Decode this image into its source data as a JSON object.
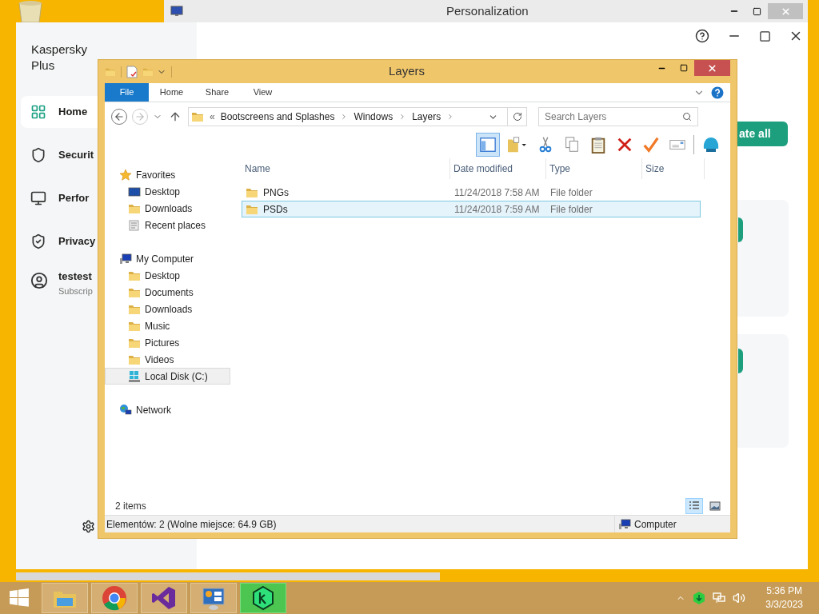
{
  "personalization_window": {
    "title": "Personalization"
  },
  "kaspersky": {
    "app_name": "Kaspersky Plus",
    "nav": [
      {
        "label": "Home",
        "selected": true
      },
      {
        "label": "Securit",
        "selected": false
      },
      {
        "label": "Perfor",
        "selected": false
      },
      {
        "label": "Privacy",
        "selected": false
      }
    ],
    "account": {
      "name": "testest",
      "subtitle": "Subscrip"
    },
    "update_button": "ate all"
  },
  "explorer": {
    "title": "Layers",
    "ribbon_tabs": [
      {
        "label": "File",
        "kind": "file"
      },
      {
        "label": "Home",
        "kind": "tab"
      },
      {
        "label": "Share",
        "kind": "tab"
      },
      {
        "label": "View",
        "kind": "tab"
      }
    ],
    "breadcrumb": {
      "overflow": "«",
      "items": [
        "Bootscreens and Splashes",
        "Windows",
        "Layers"
      ]
    },
    "search": {
      "placeholder": "Search Layers"
    },
    "toolbar_buttons": [
      {
        "selected": true
      },
      {
        "selected": false
      },
      {
        "selected": false
      },
      {
        "selected": false
      },
      {
        "selected": false
      },
      {
        "selected": false
      },
      {
        "selected": false
      },
      {
        "selected": false
      },
      {
        "selected": false
      }
    ],
    "nav_tree": [
      {
        "label": "Favorites",
        "selected": false,
        "children": [
          {
            "label": "Desktop",
            "selected": false
          },
          {
            "label": "Downloads",
            "selected": false
          },
          {
            "label": "Recent places",
            "selected": false
          }
        ]
      },
      {
        "label": "My Computer",
        "selected": false,
        "children": [
          {
            "label": "Desktop",
            "selected": false
          },
          {
            "label": "Documents",
            "selected": false
          },
          {
            "label": "Downloads",
            "selected": false
          },
          {
            "label": "Music",
            "selected": false
          },
          {
            "label": "Pictures",
            "selected": false
          },
          {
            "label": "Videos",
            "selected": false
          },
          {
            "label": "Local Disk (C:)",
            "selected": true
          }
        ]
      },
      {
        "label": "Network",
        "selected": false
      }
    ],
    "columns": [
      "Name",
      "Date modified",
      "Type",
      "Size"
    ],
    "rows": [
      {
        "name": "PNGs",
        "date": "11/24/2018 7:58 AM",
        "type": "File folder",
        "selected": false
      },
      {
        "name": "PSDs",
        "date": "11/24/2018 7:59 AM",
        "type": "File folder",
        "selected": true
      }
    ],
    "item_count": "2 items",
    "view_buttons": [
      {
        "kind": "details",
        "selected": true
      },
      {
        "kind": "large_icons",
        "selected": false
      }
    ],
    "status_bar": {
      "left": "Elementów: 2 (Wolne miejsce: 64.9 GB)",
      "right": "Computer"
    }
  },
  "taskbar": {
    "apps": [
      {
        "selected": false
      },
      {
        "selected": false
      },
      {
        "selected": false
      },
      {
        "selected": false
      },
      {
        "selected": true
      }
    ],
    "time": "5:36 PM",
    "date": "3/3/2023"
  }
}
